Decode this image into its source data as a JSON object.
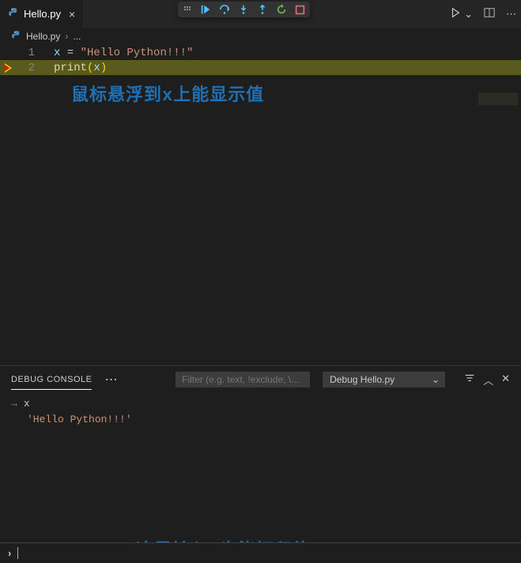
{
  "tab": {
    "filename": "Hello.py",
    "close": "×"
  },
  "breadcrumb": {
    "file": "Hello.py",
    "sep": "›",
    "more": "..."
  },
  "editor": {
    "lines": [
      {
        "num": "1",
        "var": "x",
        "op": " = ",
        "str": "\"Hello Python!!!\""
      },
      {
        "num": "2",
        "fn": "print",
        "open": "(",
        "arg": "x",
        "close": ")"
      }
    ]
  },
  "annotation1": "鼠标悬浮到x上能显示值",
  "panel": {
    "tab": "DEBUG CONSOLE",
    "more": "⋯",
    "filter_placeholder": "Filter (e.g. text, !exclude, \\...",
    "session": "Debug Hello.py"
  },
  "console": {
    "input": "x",
    "output": "'Hello Python!!!'"
  },
  "annotation2": "这里输入x也能打印值",
  "repl_prompt": "›"
}
